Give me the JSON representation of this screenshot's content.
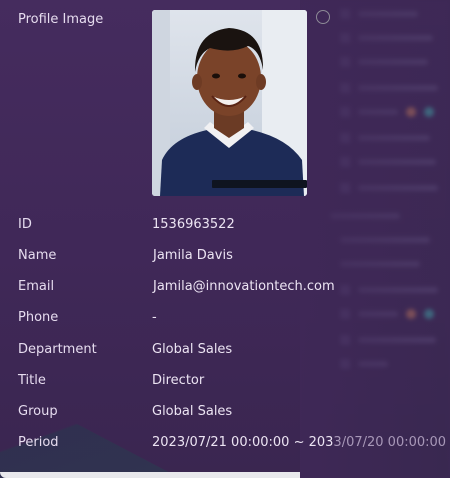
{
  "profile": {
    "image_label": "Profile Image",
    "fields": [
      {
        "label": "ID",
        "value": "1536963522"
      },
      {
        "label": "Name",
        "value": "Jamila Davis"
      },
      {
        "label": "Email",
        "value": "Jamila@innovationtech.com"
      },
      {
        "label": "Phone",
        "value": "-"
      },
      {
        "label": "Department",
        "value": "Global Sales"
      },
      {
        "label": "Title",
        "value": "Director"
      },
      {
        "label": "Group",
        "value": "Global Sales"
      },
      {
        "label": "Period",
        "value_start": "2023/07/21 00:00:00 ~ 203",
        "value_end": "3/07/20 00:00:00"
      }
    ]
  },
  "colors": {
    "panel_bg": "#462c5f",
    "label_text": "#e6dcef",
    "value_text": "#ece4f3",
    "accent_teal": "#3fb6b0",
    "accent_orange": "#d8895a"
  }
}
